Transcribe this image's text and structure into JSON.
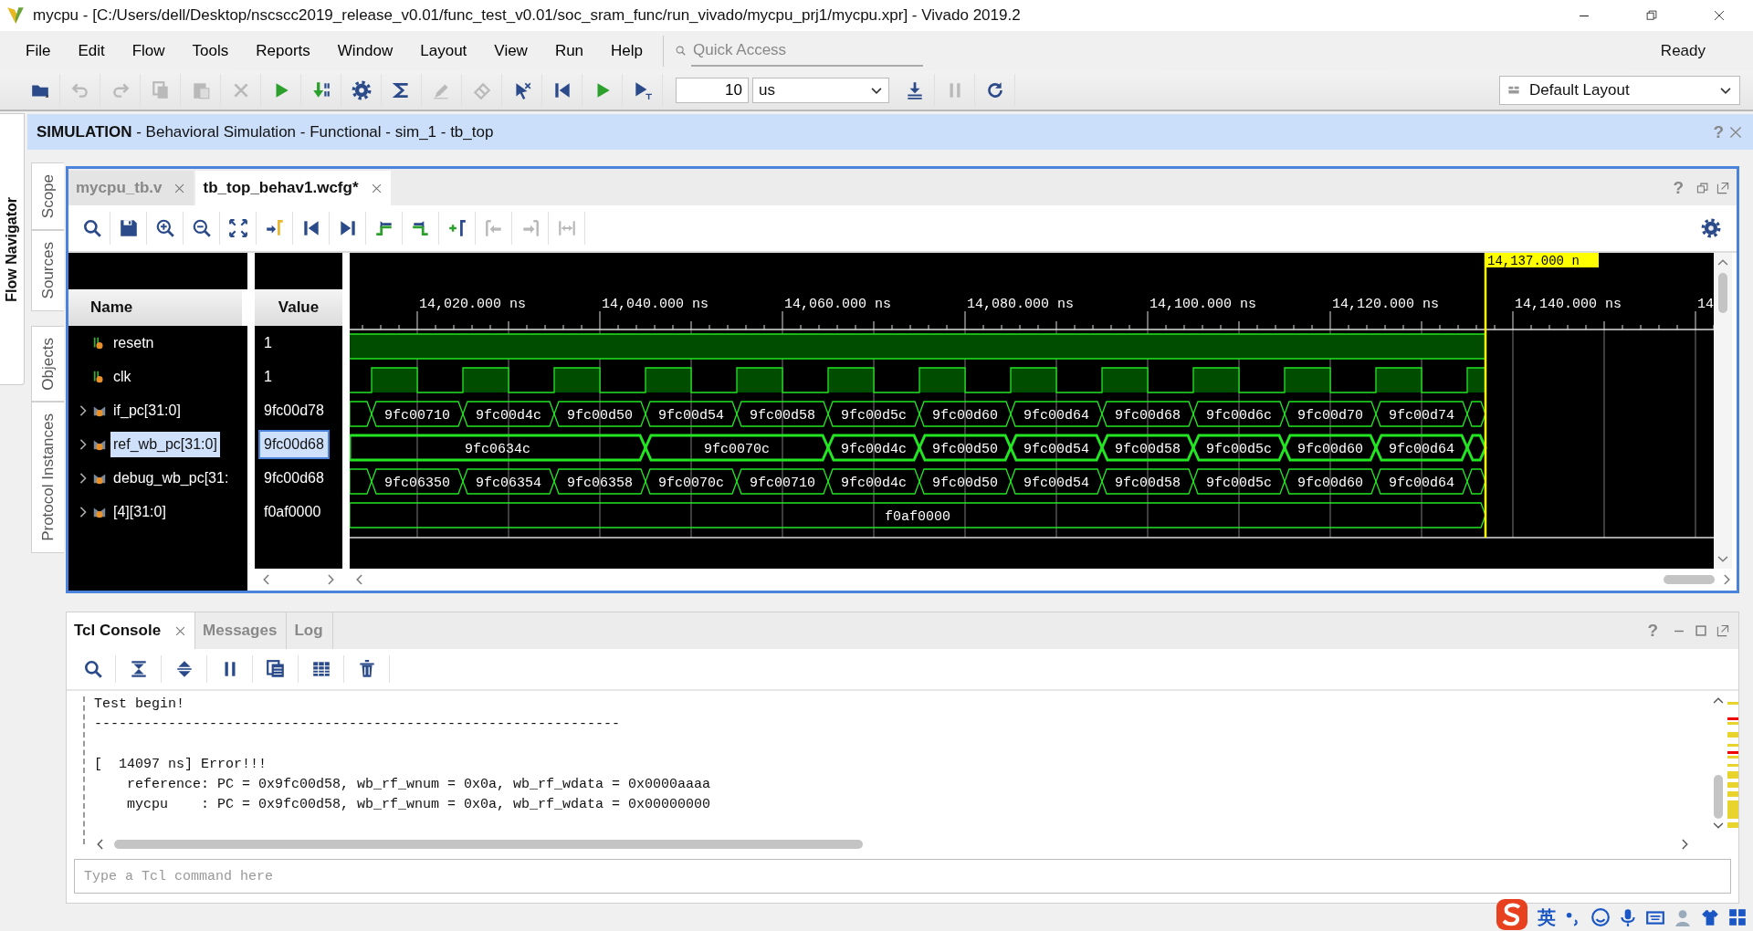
{
  "window": {
    "title": "mycpu - [C:/Users/dell/Desktop/nscscc2019_release_v0.01/func_test_v0.01/soc_sram_func/run_vivado/mycpu_prj1/mycpu.xpr] - Vivado 2019.2"
  },
  "menu": [
    "File",
    "Edit",
    "Flow",
    "Tools",
    "Reports",
    "Window",
    "Layout",
    "View",
    "Run",
    "Help"
  ],
  "quick_access": {
    "placeholder": "Quick Access"
  },
  "status": "Ready",
  "toolbar": {
    "buttons": [
      {
        "disabled": false
      },
      {
        "disabled": true
      },
      {
        "disabled": true
      },
      {
        "disabled": true
      },
      {
        "disabled": true
      },
      {
        "disabled": true
      },
      {
        "disabled": false
      },
      {
        "disabled": false
      },
      {
        "disabled": false
      },
      {
        "disabled": false
      },
      {
        "disabled": true
      },
      {
        "disabled": true
      },
      {
        "disabled": false
      },
      {
        "disabled": false
      },
      {
        "disabled": false
      },
      {
        "disabled": false
      }
    ],
    "run_time": "10",
    "run_unit": "us",
    "buttons_after": [
      {
        "disabled": false
      },
      {
        "disabled": true
      },
      {
        "disabled": false
      }
    ]
  },
  "layout_selector": "Default Layout",
  "flow_navigator": "Flow Navigator",
  "side_tabs": [
    {
      "label": "Scope"
    },
    {
      "label": "Sources"
    },
    {
      "label": "Objects"
    },
    {
      "label": "Protocol Instances"
    }
  ],
  "simulation_header": {
    "title": "**SIMULATION** - Behavioral Simulation - Functional - sim_1 - tb_top",
    "help": "?"
  },
  "editor_tabs": [
    {
      "label": "mycpu_tb.v",
      "selected": false
    },
    {
      "label": "tb_top_behav1.wcfg*",
      "selected": true
    }
  ],
  "editor_help": "?",
  "wave_toolbar": [
    {
      "disabled": false
    },
    {
      "disabled": false
    },
    {
      "disabled": false
    },
    {
      "disabled": false
    },
    {
      "disabled": false
    },
    {
      "disabled": false
    },
    {
      "disabled": false
    },
    {
      "disabled": false
    },
    {
      "disabled": false
    },
    {
      "disabled": false
    },
    {
      "disabled": false
    },
    {
      "disabled": true
    },
    {
      "disabled": true
    },
    {
      "disabled": true
    }
  ],
  "waveform": {
    "columns": [
      "Name",
      "Value"
    ],
    "cursor": {
      "label": "14,137.000 n"
    },
    "ticks": [
      "14,020.000 ns",
      "14,040.000 ns",
      "14,060.000 ns",
      "14,080.000 ns",
      "14,100.000 ns",
      "14,120.000 ns",
      "14,140.000 ns",
      "14"
    ],
    "signals": [
      {
        "name": "resetn",
        "value": "1",
        "kind": "bit",
        "expandable": false,
        "selected": false
      },
      {
        "name": "clk",
        "value": "1",
        "kind": "clock",
        "expandable": false,
        "selected": false
      },
      {
        "name": "if_pc[31:0]",
        "value": "9fc00d78",
        "kind": "bus",
        "expandable": true,
        "selected": false,
        "segments": [
          {
            "value": "9fc00710",
            "kind": "single"
          },
          {
            "value": "9fc00d4c",
            "kind": "single"
          },
          {
            "value": "9fc00d50",
            "kind": "single"
          },
          {
            "value": "9fc00d54",
            "kind": "single"
          },
          {
            "value": "9fc00d58",
            "kind": "single"
          },
          {
            "value": "9fc00d5c",
            "kind": "single"
          },
          {
            "value": "9fc00d60",
            "kind": "single"
          },
          {
            "value": "9fc00d64",
            "kind": "single"
          },
          {
            "value": "9fc00d68",
            "kind": "single"
          },
          {
            "value": "9fc00d6c",
            "kind": "single"
          },
          {
            "value": "9fc00d70",
            "kind": "single"
          },
          {
            "value": "9fc00d74",
            "kind": "single"
          }
        ]
      },
      {
        "name": "ref_wb_pc[31:0]",
        "value": "9fc00d68",
        "kind": "bus",
        "expandable": true,
        "selected": true,
        "segments": [
          {
            "value": "9fc0634c",
            "kind": "open"
          },
          {
            "value": "9fc0070c",
            "kind": "double"
          },
          {
            "value": "9fc00d4c",
            "kind": "single"
          },
          {
            "value": "9fc00d50",
            "kind": "single"
          },
          {
            "value": "9fc00d54",
            "kind": "single"
          },
          {
            "value": "9fc00d58",
            "kind": "single"
          },
          {
            "value": "9fc00d5c",
            "kind": "single"
          },
          {
            "value": "9fc00d60",
            "kind": "single"
          },
          {
            "value": "9fc00d64",
            "kind": "single"
          }
        ]
      },
      {
        "name": "debug_wb_pc[31:",
        "value": "9fc00d68",
        "kind": "bus",
        "expandable": true,
        "selected": false,
        "segments": [
          {
            "value": "9fc06350",
            "kind": "single"
          },
          {
            "value": "9fc06354",
            "kind": "single"
          },
          {
            "value": "9fc06358",
            "kind": "single"
          },
          {
            "value": "9fc0070c",
            "kind": "single"
          },
          {
            "value": "9fc00710",
            "kind": "single"
          },
          {
            "value": "9fc00d4c",
            "kind": "single"
          },
          {
            "value": "9fc00d50",
            "kind": "single"
          },
          {
            "value": "9fc00d54",
            "kind": "single"
          },
          {
            "value": "9fc00d58",
            "kind": "single"
          },
          {
            "value": "9fc00d5c",
            "kind": "single"
          },
          {
            "value": "9fc00d60",
            "kind": "single"
          },
          {
            "value": "9fc00d64",
            "kind": "single"
          }
        ]
      },
      {
        "name": "[4][31:0]",
        "value": "f0af0000",
        "kind": "bus",
        "expandable": true,
        "selected": false,
        "segments": [
          {
            "value": "f0af0000",
            "kind": "open"
          }
        ]
      }
    ]
  },
  "console": {
    "tabs": [
      {
        "label": "Tcl Console",
        "selected": true,
        "closable": true
      },
      {
        "label": "Messages",
        "selected": false,
        "closable": false
      },
      {
        "label": "Log",
        "selected": false,
        "closable": false
      }
    ],
    "help": "?",
    "blocks": [
      [
        "Test begin!",
        "----------------------------------------------------------------"
      ],
      [
        "[  14097 ns] Error!!!",
        "    reference: PC = 0x9fc00d58, wb_rf_wnum = 0x0a, wb_rf_wdata = 0x0000aaaa",
        "    mycpu    : PC = 0x9fc00d58, wb_rf_wnum = 0x0a, wb_rf_wdata = 0x00000000"
      ]
    ],
    "input": {
      "placeholder": "Type a Tcl command here"
    }
  },
  "ime": {
    "mode": "英"
  }
}
